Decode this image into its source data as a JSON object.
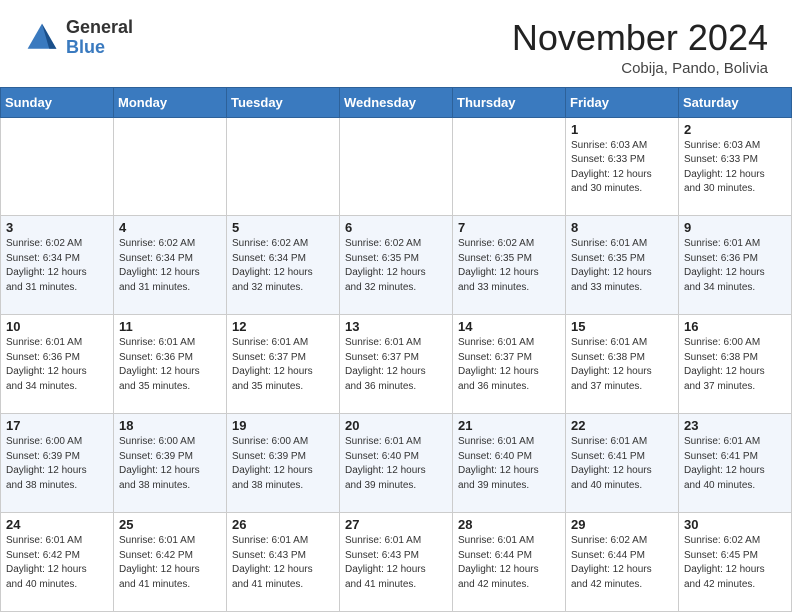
{
  "header": {
    "logo_general": "General",
    "logo_blue": "Blue",
    "month_title": "November 2024",
    "location": "Cobija, Pando, Bolivia"
  },
  "weekdays": [
    "Sunday",
    "Monday",
    "Tuesday",
    "Wednesday",
    "Thursday",
    "Friday",
    "Saturday"
  ],
  "weeks": [
    [
      {
        "day": "",
        "info": ""
      },
      {
        "day": "",
        "info": ""
      },
      {
        "day": "",
        "info": ""
      },
      {
        "day": "",
        "info": ""
      },
      {
        "day": "",
        "info": ""
      },
      {
        "day": "1",
        "info": "Sunrise: 6:03 AM\nSunset: 6:33 PM\nDaylight: 12 hours\nand 30 minutes."
      },
      {
        "day": "2",
        "info": "Sunrise: 6:03 AM\nSunset: 6:33 PM\nDaylight: 12 hours\nand 30 minutes."
      }
    ],
    [
      {
        "day": "3",
        "info": "Sunrise: 6:02 AM\nSunset: 6:34 PM\nDaylight: 12 hours\nand 31 minutes."
      },
      {
        "day": "4",
        "info": "Sunrise: 6:02 AM\nSunset: 6:34 PM\nDaylight: 12 hours\nand 31 minutes."
      },
      {
        "day": "5",
        "info": "Sunrise: 6:02 AM\nSunset: 6:34 PM\nDaylight: 12 hours\nand 32 minutes."
      },
      {
        "day": "6",
        "info": "Sunrise: 6:02 AM\nSunset: 6:35 PM\nDaylight: 12 hours\nand 32 minutes."
      },
      {
        "day": "7",
        "info": "Sunrise: 6:02 AM\nSunset: 6:35 PM\nDaylight: 12 hours\nand 33 minutes."
      },
      {
        "day": "8",
        "info": "Sunrise: 6:01 AM\nSunset: 6:35 PM\nDaylight: 12 hours\nand 33 minutes."
      },
      {
        "day": "9",
        "info": "Sunrise: 6:01 AM\nSunset: 6:36 PM\nDaylight: 12 hours\nand 34 minutes."
      }
    ],
    [
      {
        "day": "10",
        "info": "Sunrise: 6:01 AM\nSunset: 6:36 PM\nDaylight: 12 hours\nand 34 minutes."
      },
      {
        "day": "11",
        "info": "Sunrise: 6:01 AM\nSunset: 6:36 PM\nDaylight: 12 hours\nand 35 minutes."
      },
      {
        "day": "12",
        "info": "Sunrise: 6:01 AM\nSunset: 6:37 PM\nDaylight: 12 hours\nand 35 minutes."
      },
      {
        "day": "13",
        "info": "Sunrise: 6:01 AM\nSunset: 6:37 PM\nDaylight: 12 hours\nand 36 minutes."
      },
      {
        "day": "14",
        "info": "Sunrise: 6:01 AM\nSunset: 6:37 PM\nDaylight: 12 hours\nand 36 minutes."
      },
      {
        "day": "15",
        "info": "Sunrise: 6:01 AM\nSunset: 6:38 PM\nDaylight: 12 hours\nand 37 minutes."
      },
      {
        "day": "16",
        "info": "Sunrise: 6:00 AM\nSunset: 6:38 PM\nDaylight: 12 hours\nand 37 minutes."
      }
    ],
    [
      {
        "day": "17",
        "info": "Sunrise: 6:00 AM\nSunset: 6:39 PM\nDaylight: 12 hours\nand 38 minutes."
      },
      {
        "day": "18",
        "info": "Sunrise: 6:00 AM\nSunset: 6:39 PM\nDaylight: 12 hours\nand 38 minutes."
      },
      {
        "day": "19",
        "info": "Sunrise: 6:00 AM\nSunset: 6:39 PM\nDaylight: 12 hours\nand 38 minutes."
      },
      {
        "day": "20",
        "info": "Sunrise: 6:01 AM\nSunset: 6:40 PM\nDaylight: 12 hours\nand 39 minutes."
      },
      {
        "day": "21",
        "info": "Sunrise: 6:01 AM\nSunset: 6:40 PM\nDaylight: 12 hours\nand 39 minutes."
      },
      {
        "day": "22",
        "info": "Sunrise: 6:01 AM\nSunset: 6:41 PM\nDaylight: 12 hours\nand 40 minutes."
      },
      {
        "day": "23",
        "info": "Sunrise: 6:01 AM\nSunset: 6:41 PM\nDaylight: 12 hours\nand 40 minutes."
      }
    ],
    [
      {
        "day": "24",
        "info": "Sunrise: 6:01 AM\nSunset: 6:42 PM\nDaylight: 12 hours\nand 40 minutes."
      },
      {
        "day": "25",
        "info": "Sunrise: 6:01 AM\nSunset: 6:42 PM\nDaylight: 12 hours\nand 41 minutes."
      },
      {
        "day": "26",
        "info": "Sunrise: 6:01 AM\nSunset: 6:43 PM\nDaylight: 12 hours\nand 41 minutes."
      },
      {
        "day": "27",
        "info": "Sunrise: 6:01 AM\nSunset: 6:43 PM\nDaylight: 12 hours\nand 41 minutes."
      },
      {
        "day": "28",
        "info": "Sunrise: 6:01 AM\nSunset: 6:44 PM\nDaylight: 12 hours\nand 42 minutes."
      },
      {
        "day": "29",
        "info": "Sunrise: 6:02 AM\nSunset: 6:44 PM\nDaylight: 12 hours\nand 42 minutes."
      },
      {
        "day": "30",
        "info": "Sunrise: 6:02 AM\nSunset: 6:45 PM\nDaylight: 12 hours\nand 42 minutes."
      }
    ]
  ]
}
